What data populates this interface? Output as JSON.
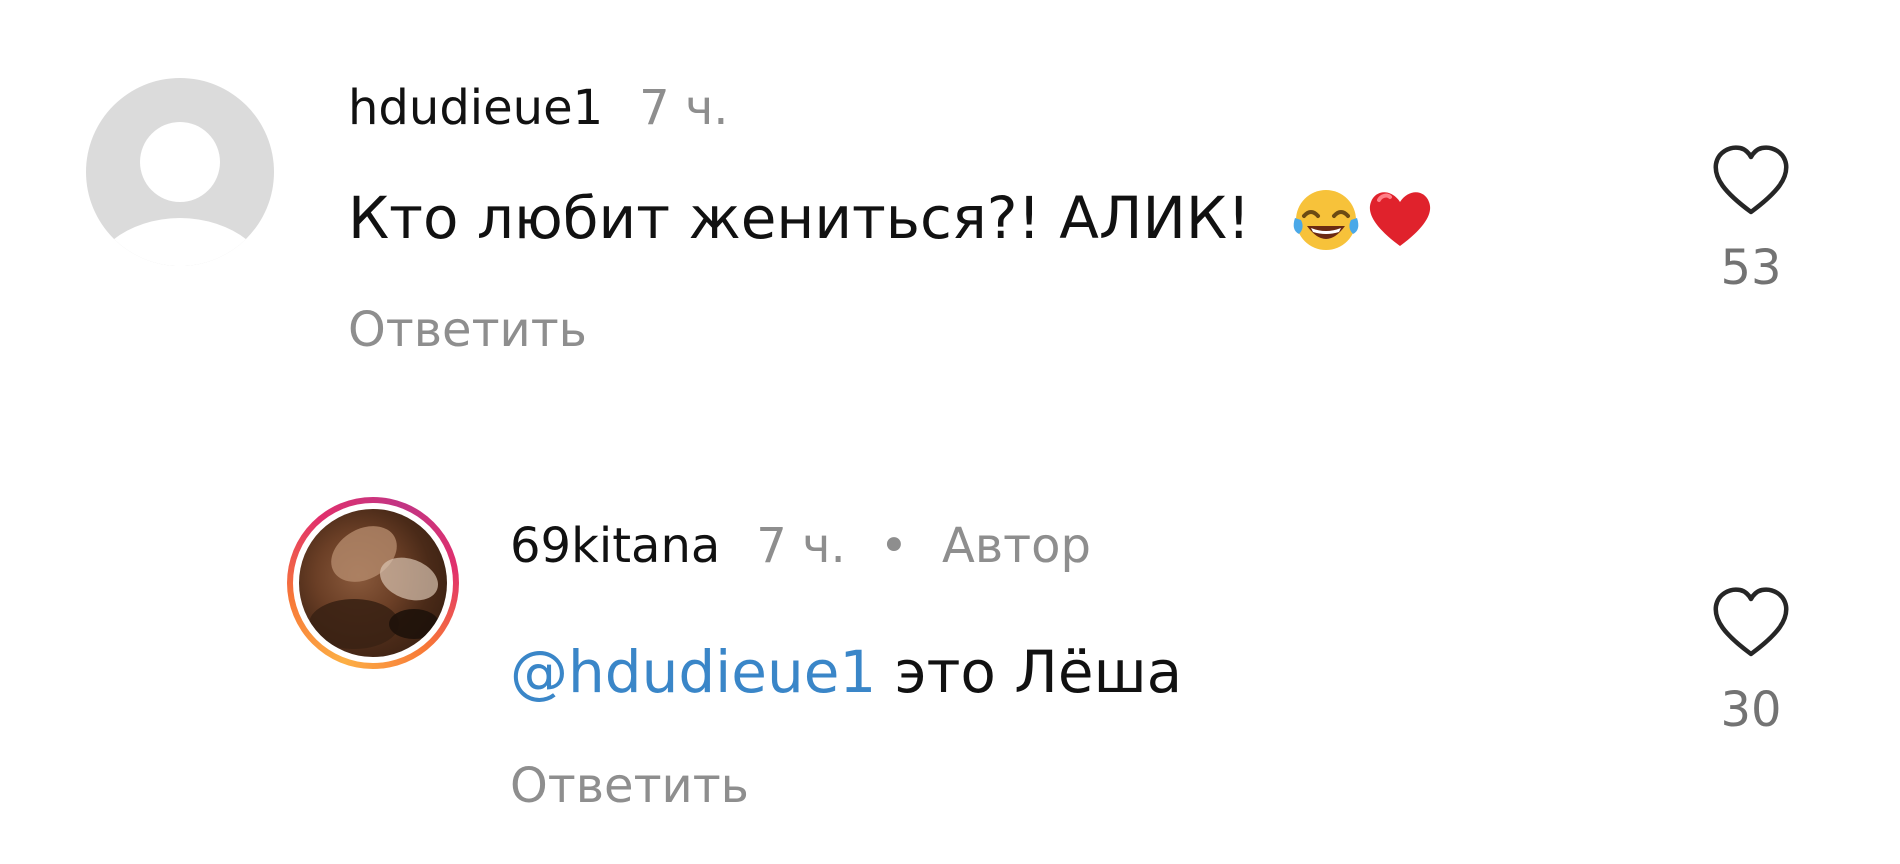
{
  "comments": [
    {
      "username": "hdudieue1",
      "time": "7 ч.",
      "text": "Кто любит жениться?! АЛИК!",
      "emojis": [
        "joy-tears-emoji",
        "red-heart-emoji"
      ],
      "reply_label": "Ответить",
      "likes": "53"
    },
    {
      "username": "69kitana",
      "time": "7 ч.",
      "separator": "•",
      "badge": "Автор",
      "mention": "@hdudieue1",
      "text": " это Лёша",
      "reply_label": "Ответить",
      "likes": "30"
    }
  ],
  "colors": {
    "mention": "#3a86c8",
    "muted": "#8e8e8e",
    "avatar_placeholder": "#dbdbdb"
  }
}
